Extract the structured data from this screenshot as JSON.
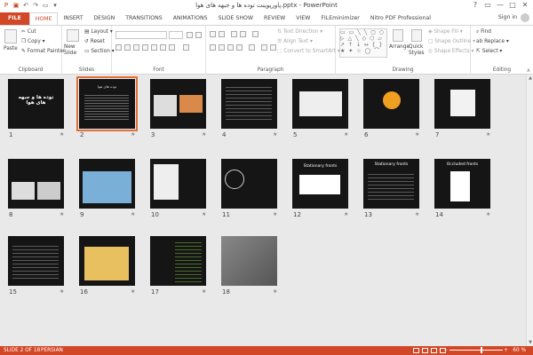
{
  "window": {
    "title": "پاورپوینت توده ها و جبهه های هوا.pptx - PowerPoint",
    "controls": [
      "?",
      "▭",
      "—",
      "□",
      "✕"
    ]
  },
  "tabs": [
    "FILE",
    "HOME",
    "INSERT",
    "DESIGN",
    "TRANSITIONS",
    "ANIMATIONS",
    "SLIDE SHOW",
    "REVIEW",
    "VIEW",
    "FILEminimizer",
    "Nitro PDF Professional"
  ],
  "active_tab": "HOME",
  "signin": "Sign in",
  "ribbon": {
    "clipboard": {
      "paste": "Paste",
      "cut": "Cut",
      "copy": "Copy",
      "format_painter": "Format Painter",
      "label": "Clipboard"
    },
    "slides": {
      "new_slide": "New Slide",
      "layout": "Layout",
      "reset": "Reset",
      "section": "Section",
      "label": "Slides"
    },
    "font": {
      "label": "Font"
    },
    "paragraph": {
      "text_direction": "Text Direction",
      "align_text": "Align Text",
      "convert": "Convert to SmartArt",
      "label": "Paragraph"
    },
    "drawing": {
      "arrange": "Arrange",
      "quick_styles": "Quick Styles",
      "shape_fill": "Shape Fill",
      "shape_outline": "Shape Outline",
      "shape_effects": "Shape Effects",
      "label": "Drawing"
    },
    "editing": {
      "find": "Find",
      "replace": "Replace",
      "select": "Select",
      "label": "Editing"
    }
  },
  "slides": [
    {
      "n": "1"
    },
    {
      "n": "2"
    },
    {
      "n": "3"
    },
    {
      "n": "4"
    },
    {
      "n": "5"
    },
    {
      "n": "6"
    },
    {
      "n": "7"
    },
    {
      "n": "8"
    },
    {
      "n": "9"
    },
    {
      "n": "10"
    },
    {
      "n": "11"
    },
    {
      "n": "12"
    },
    {
      "n": "13"
    },
    {
      "n": "14"
    },
    {
      "n": "15"
    },
    {
      "n": "16"
    },
    {
      "n": "17"
    },
    {
      "n": "18"
    }
  ],
  "slide_text": {
    "s1": "توده ها و جبهه های هوا",
    "s2": "توده های هوا",
    "s12": "Stationary fronts",
    "s13": "Stationary fronts",
    "s14": "Occluded fronts"
  },
  "selected_slide": "2",
  "status": {
    "slide": "SLIDE 2 OF 18",
    "language": "PERSIAN",
    "zoom": "60 %",
    "zoom_level": 0.6
  },
  "colors": {
    "accent": "#d24726",
    "selection": "#e0703a"
  }
}
